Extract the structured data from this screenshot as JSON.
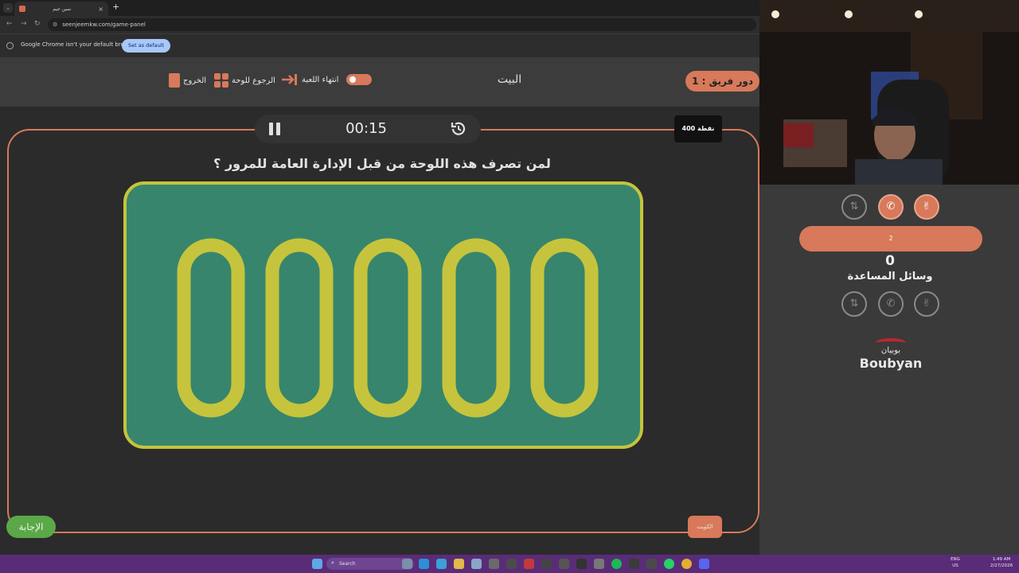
{
  "browser": {
    "tab_title": "سين جيم",
    "tab_close": "×",
    "new_tab": "+",
    "url": "seenjeemkw.com/game-panel",
    "infobar_text": "Google Chrome isn't your default browser",
    "set_default_label": "Set as default"
  },
  "header": {
    "turn_label": "دور فريق : 1",
    "category": "البيت",
    "end_game_label": "انتهاء اللعبة",
    "back_to_board_label": "الرجوع للوحة",
    "exit_label": "الخروج"
  },
  "board": {
    "timer": "00:15",
    "points": "400 نقطة",
    "question": "لمن تصرف هذه اللوحة من قبل الإدارة العامة للمرور ؟",
    "plate_text": "00000",
    "team_corner_label": "الكويت",
    "answer_label": "الإجابة"
  },
  "right_panel": {
    "team_name": "2",
    "score": "0",
    "aids_label": "وسائل المساعدة",
    "sponsor_ar": "بوبيان",
    "sponsor_en": "Boubyan"
  },
  "taskbar": {
    "search_placeholder": "Search",
    "lang": "ENG",
    "region": "US",
    "time": "1:49 AM",
    "date": "2/27/2026"
  },
  "colors": {
    "accent": "#d7795a",
    "plate_bg": "#37856d",
    "plate_fg": "#c6c43c",
    "answer_green": "#5aa847",
    "taskbar": "#5a2c78"
  },
  "icons": [
    "pause-icon",
    "reset-timer-icon",
    "arrow-right-icon",
    "grid-icon",
    "door-exit-icon",
    "double-points-icon",
    "phone-icon",
    "victory-hand-icon",
    "search-icon",
    "windows-start-icon"
  ]
}
